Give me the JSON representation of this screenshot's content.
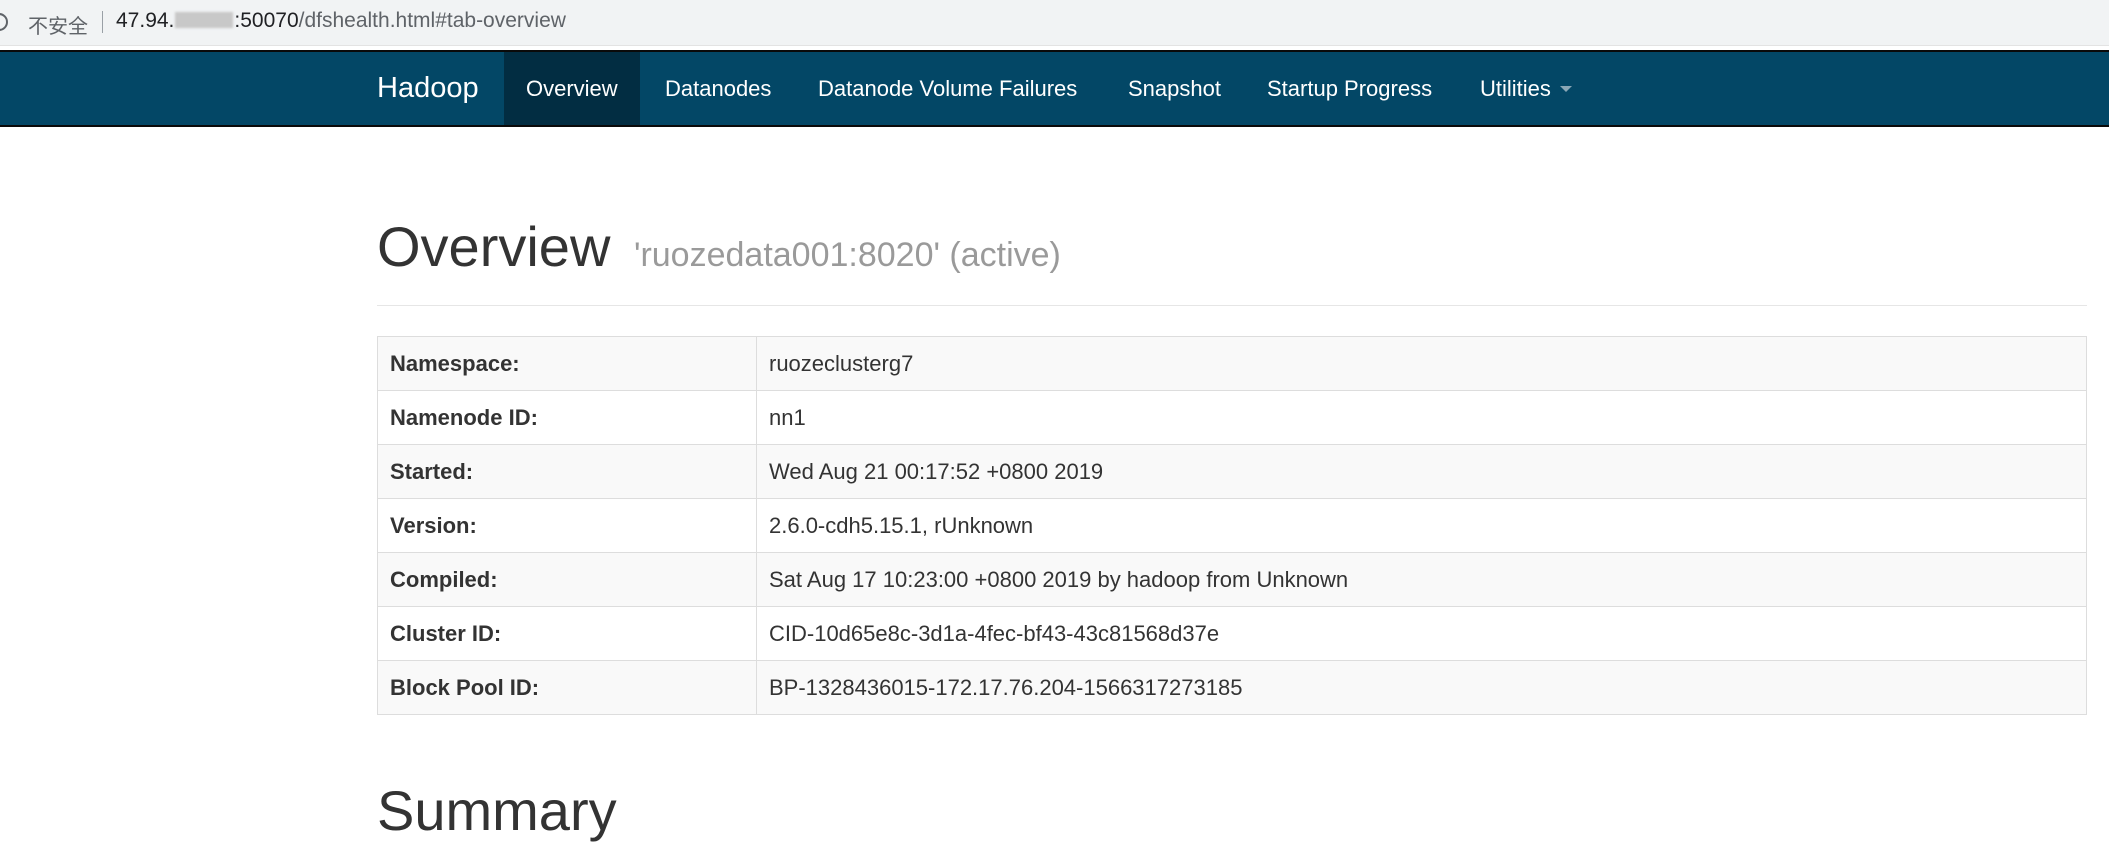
{
  "browser": {
    "security_label": "不安全",
    "url_host_prefix": "47.94.",
    "url_host_suffix": ":50070",
    "url_path": "/dfshealth.html#tab-overview"
  },
  "navbar": {
    "brand": "Hadoop",
    "items": [
      {
        "label": "Overview",
        "active": true
      },
      {
        "label": "Datanodes"
      },
      {
        "label": "Datanode Volume Failures"
      },
      {
        "label": "Snapshot"
      },
      {
        "label": "Startup Progress"
      },
      {
        "label": "Utilities",
        "dropdown": true
      }
    ]
  },
  "overview": {
    "title": "Overview",
    "subtitle": "'ruozedata001:8020' (active)",
    "rows": [
      {
        "label": "Namespace:",
        "value": "ruozeclusterg7"
      },
      {
        "label": "Namenode ID:",
        "value": "nn1"
      },
      {
        "label": "Started:",
        "value": "Wed Aug 21 00:17:52 +0800 2019"
      },
      {
        "label": "Version:",
        "value": "2.6.0-cdh5.15.1, rUnknown"
      },
      {
        "label": "Compiled:",
        "value": "Sat Aug 17 10:23:00 +0800 2019 by hadoop from Unknown"
      },
      {
        "label": "Cluster ID:",
        "value": "CID-10d65e8c-3d1a-4fec-bf43-43c81568d37e"
      },
      {
        "label": "Block Pool ID:",
        "value": "BP-1328436015-172.17.76.204-1566317273185"
      }
    ]
  },
  "summary": {
    "title": "Summary"
  },
  "colors": {
    "navbar_bg": "#034766",
    "navbar_active_bg": "#022d42",
    "subtitle_gray": "#9a9a9a"
  }
}
